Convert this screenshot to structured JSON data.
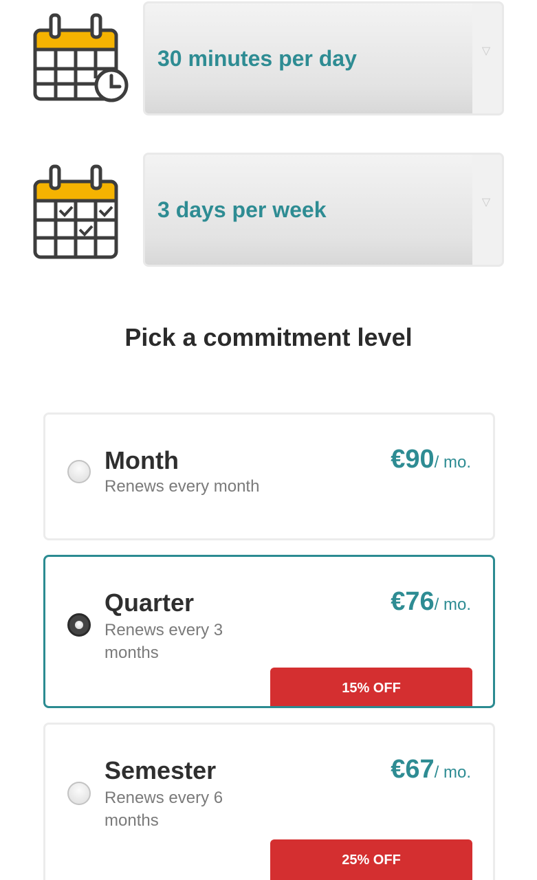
{
  "schedule": {
    "duration": {
      "value": "30 minutes per day",
      "icon": "calendar-clock-icon"
    },
    "frequency": {
      "value": "3 days per week",
      "icon": "calendar-check-icon"
    }
  },
  "commitment": {
    "title": "Pick a commitment level",
    "plans": [
      {
        "name": "Month",
        "description": "Renews every month",
        "price": "€90",
        "unit": "/ mo.",
        "selected": false,
        "badge": ""
      },
      {
        "name": "Quarter",
        "description": "Renews every 3 months",
        "price": "€76",
        "unit": "/ mo.",
        "selected": true,
        "badge": "15% OFF"
      },
      {
        "name": "Semester",
        "description": "Renews every 6 months",
        "price": "€67",
        "unit": "/ mo.",
        "selected": false,
        "badge": "25% OFF"
      }
    ]
  },
  "colors": {
    "accent": "#2e8c93",
    "calendar_header": "#f5b301",
    "discount": "#d42f30",
    "text_dark": "#2f2f2f"
  }
}
